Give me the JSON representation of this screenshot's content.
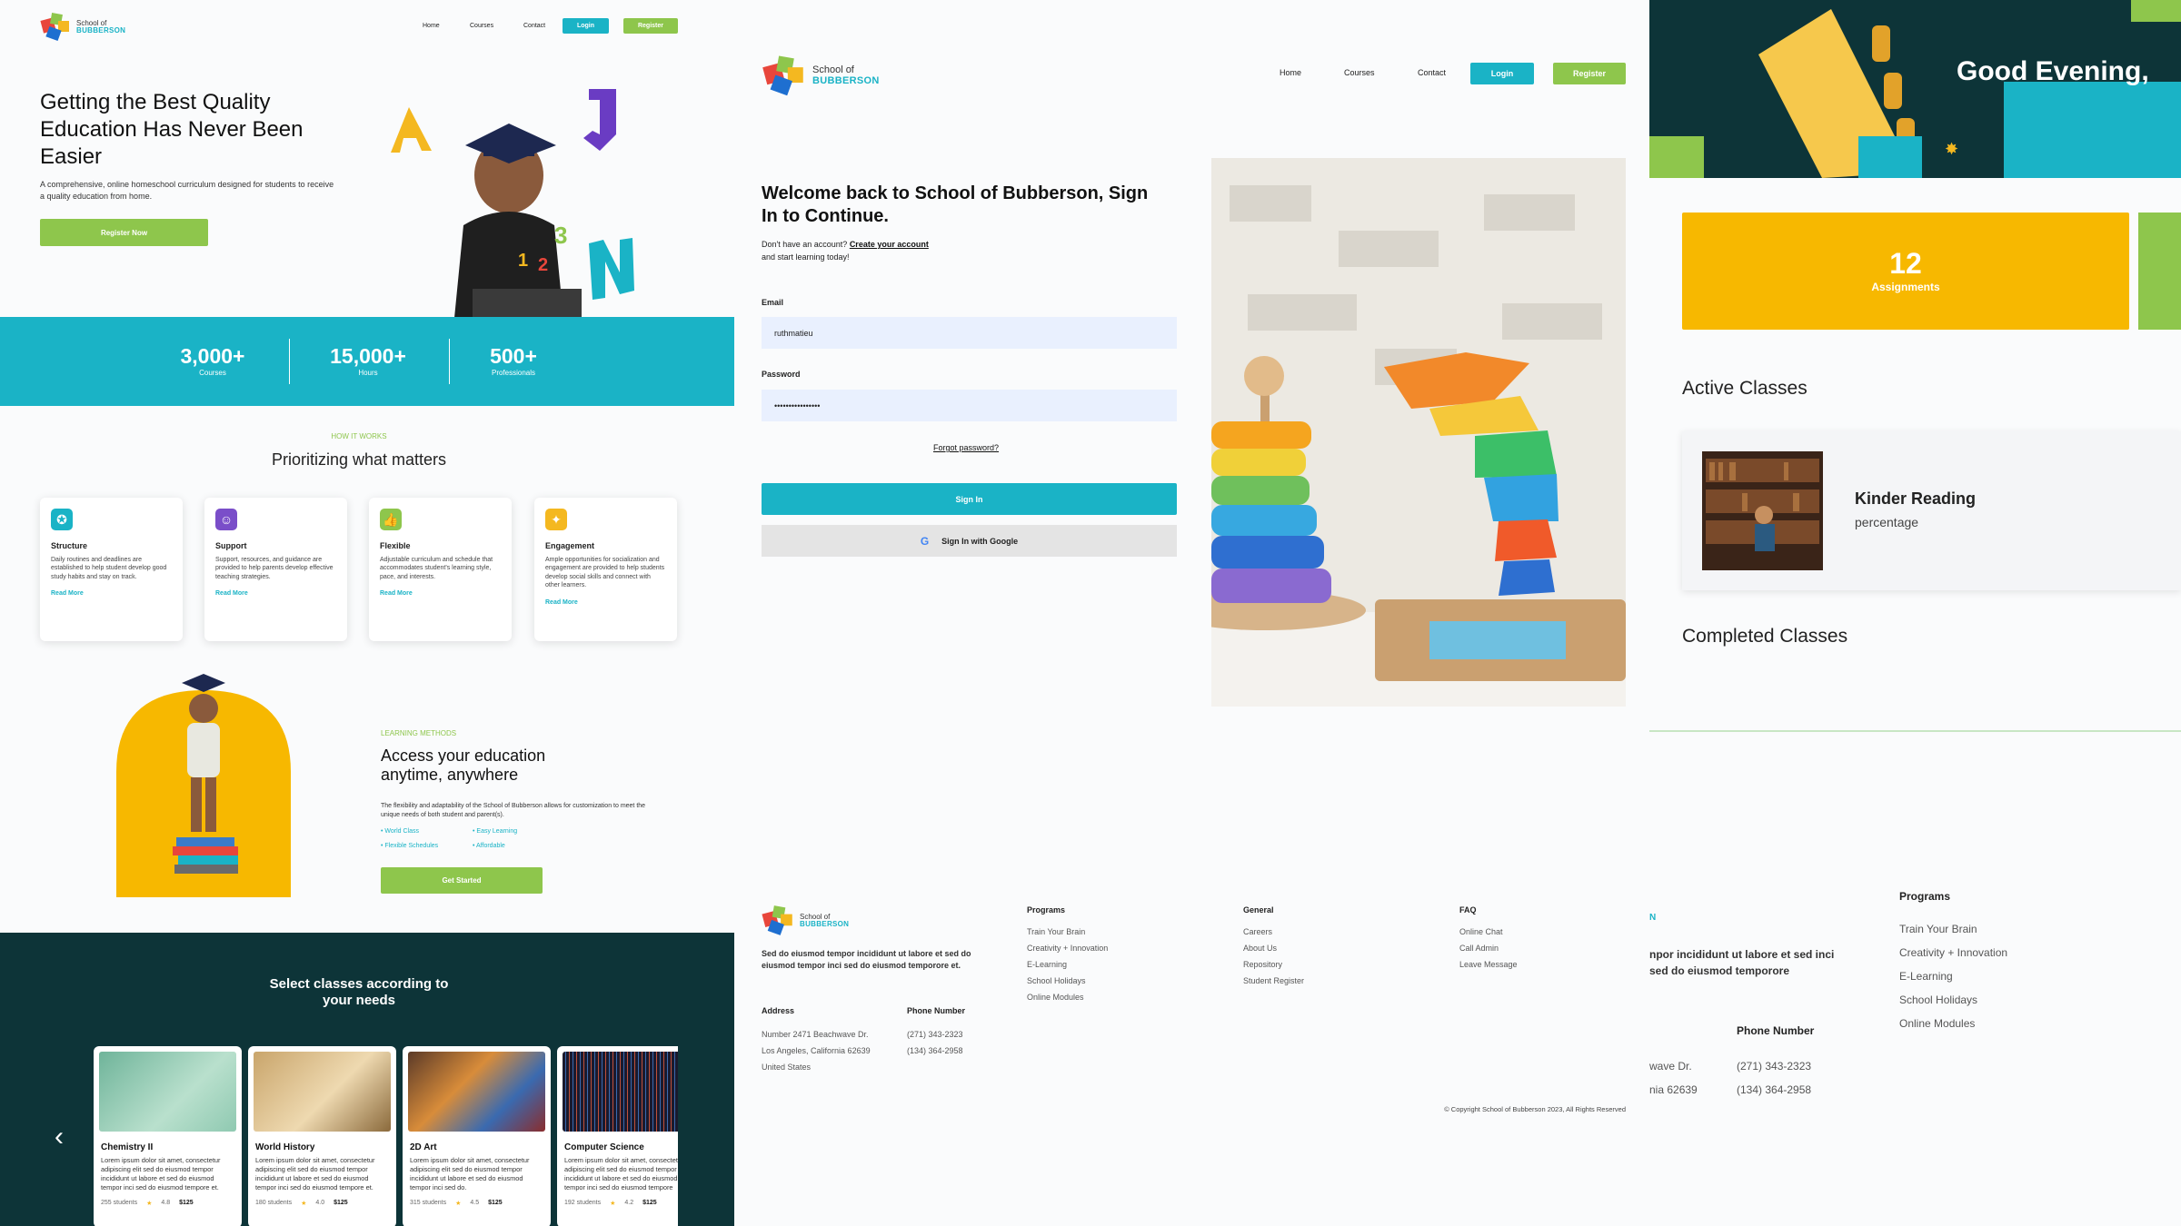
{
  "brand": {
    "line1": "School of",
    "line2": "BUBBERSON"
  },
  "nav": {
    "home": "Home",
    "courses": "Courses",
    "contact": "Contact",
    "login": "Login",
    "register": "Register"
  },
  "landing": {
    "hero_title": "Getting the Best Quality Education Has Never Been Easier",
    "hero_sub": "A comprehensive, online homeschool curriculum designed for students to receive a quality education from home.",
    "hero_cta": "Register Now",
    "stats": [
      {
        "value": "3,000+",
        "label": "Courses"
      },
      {
        "value": "15,000+",
        "label": "Hours"
      },
      {
        "value": "500+",
        "label": "Professionals"
      }
    ],
    "how_eyebrow": "HOW IT WORKS",
    "how_title": "Prioritizing what matters",
    "features": [
      {
        "title": "Structure",
        "desc": "Daily routines and deadlines are established to help student develop good study habits and stay on track.",
        "link": "Read More",
        "color": "#1ab3c6",
        "icon": "ribbon-icon"
      },
      {
        "title": "Support",
        "desc": "Support, resources, and guidance are provided to help parents develop effective teaching strategies.",
        "link": "Read More",
        "color": "#7a4ec9",
        "icon": "smile-icon"
      },
      {
        "title": "Flexible",
        "desc": "Adjustable curriculum and schedule that accommodates student's learning style, pace, and interests.",
        "link": "Read More",
        "color": "#8ec64c",
        "icon": "thumbs-up-icon"
      },
      {
        "title": "Engagement",
        "desc": "Ample opportunities for socialization and engagement are provided to help students develop social skills and connect with other learners.",
        "link": "Read More",
        "color": "#f4b820",
        "icon": "bulb-icon"
      }
    ],
    "methods_eyebrow": "LEARNING METHODS",
    "methods_title": "Access your education anytime, anywhere",
    "methods_desc": "The flexibility and adaptability of the School of Bubberson allows for customization to meet the unique needs of both student and parent(s).",
    "methods_list": [
      "World Class",
      "Easy Learning",
      "Flexible Schedules",
      "Affordable"
    ],
    "methods_cta": "Get Started",
    "classes_title": "Select classes according to your needs",
    "classes": [
      {
        "title": "Chemistry II",
        "desc": "Lorem ipsum dolor sit amet, consectetur adipiscing elit sed do eiusmod tempor incididunt ut labore et sed do eiusmod tempor inci sed do eiusmod tempore et.",
        "students": "255 students",
        "rating": "4.8",
        "price": "$125"
      },
      {
        "title": "World History",
        "desc": "Lorem ipsum dolor sit amet, consectetur adipiscing elit sed do eiusmod tempor incididunt ut labore et sed do eiusmod tempor inci sed do eiusmod tempore et.",
        "students": "180 students",
        "rating": "4.0",
        "price": "$125"
      },
      {
        "title": "2D Art",
        "desc": "Lorem ipsum dolor sit amet, consectetur adipiscing elit sed do eiusmod tempor incididunt ut labore et sed do eiusmod tempor inci sed do.",
        "students": "315 students",
        "rating": "4.5",
        "price": "$125"
      },
      {
        "title": "Computer Science",
        "desc": "Lorem ipsum dolor sit amet, consectetur adipiscing elit sed do eiusmod tempor incididunt ut labore et sed do eiusmod tempor inci sed do eiusmod tempore",
        "students": "192 students",
        "rating": "4.2",
        "price": "$125"
      }
    ]
  },
  "signin": {
    "title": "Welcome back to School of Bubberson, Sign In to Continue.",
    "no_account": "Don't have an account?",
    "create_link": "Create your account",
    "start": "and start learning today!",
    "email_label": "Email",
    "email_value": "ruthmatieu",
    "password_label": "Password",
    "password_value": "••••••••••••••••",
    "forgot": "Forgot password?",
    "signin_btn": "Sign In",
    "google_btn": "Sign In with Google"
  },
  "footer": {
    "blurb": "Sed do eiusmod tempor incididunt ut labore et sed do eiusmod tempor inci sed do eiusmod temporore et.",
    "address_label": "Address",
    "address": [
      "Number 2471 Beachwave Dr.",
      "Los Angeles, California 62639",
      "United States"
    ],
    "phone_label": "Phone Number",
    "phones": [
      "(271) 343-2323",
      "(134) 364-2958"
    ],
    "programs_label": "Programs",
    "programs": [
      "Train Your Brain",
      "Creativity + Innovation",
      "E-Learning",
      "School Holidays",
      "Online Modules"
    ],
    "general_label": "General",
    "general": [
      "Careers",
      "About Us",
      "Repository",
      "Student Register"
    ],
    "faq_label": "FAQ",
    "faq": [
      "Online Chat",
      "Call Admin",
      "Leave Message"
    ],
    "copyright": "© Copyright School of Bubberson 2023, All Rights Reserved"
  },
  "dashboard": {
    "greeting": "Good Evening,",
    "assignments_value": "12",
    "assignments_label": "Assignments",
    "active_title": "Active Classes",
    "class_name": "Kinder Reading",
    "class_sub": "percentage",
    "completed_title": "Completed Classes",
    "footer_blurb": "npor incididunt ut labore et sed inci sed do eiusmod temporore",
    "footer_phone_label": "Phone Number",
    "footer_addr": [
      "wave Dr.",
      "nia 62639"
    ],
    "footer_phones": [
      "(271) 343-2323",
      "(134) 364-2958"
    ],
    "footer_programs_label": "Programs",
    "footer_programs": [
      "Train Your Brain",
      "Creativity + Innovation",
      "E-Learning",
      "School Holidays",
      "Online Modules"
    ],
    "footer_brand_frag": "N"
  }
}
